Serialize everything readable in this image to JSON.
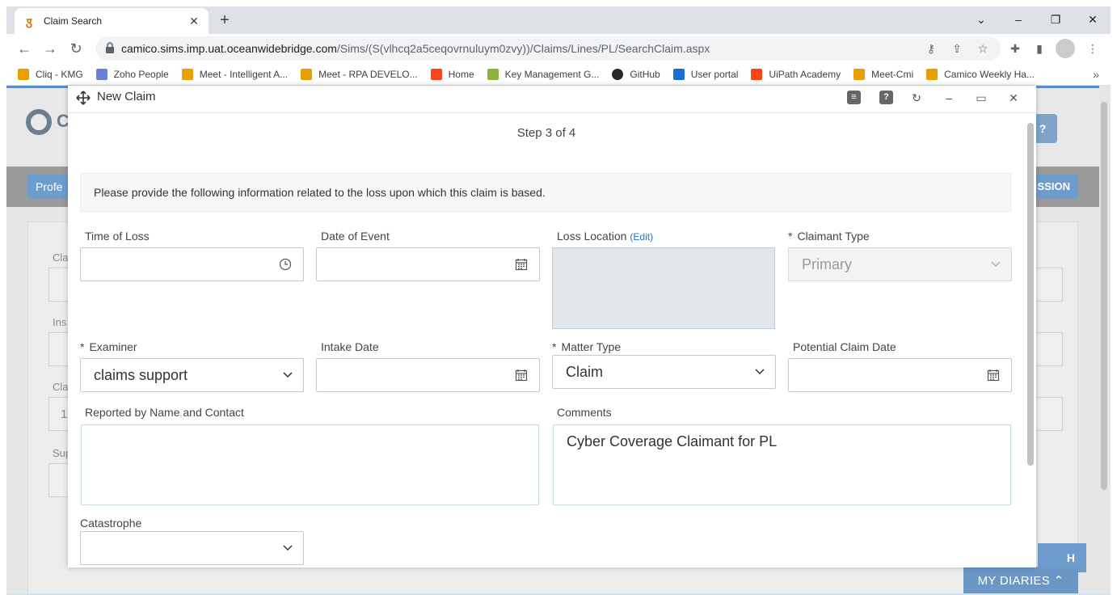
{
  "browser": {
    "tab_title": "Claim Search",
    "tab_favicon": "claim-favicon",
    "new_tab_label": "+",
    "url_host": "camico.sims.imp.uat.oceanwidebridge.com",
    "url_path": "/Sims/(S(vlhcq2a5ceqovrnuluym0zvy))/Claims/Lines/PL/SearchClaim.aspx",
    "bookmarks": [
      {
        "label": "Cliq - KMG",
        "color": "#e8a000",
        "icon": "C"
      },
      {
        "label": "Zoho People",
        "color": "#6a7fd6",
        "icon": "Z"
      },
      {
        "label": "Meet - Intelligent A...",
        "color": "#e8a000",
        "icon": "M"
      },
      {
        "label": "Meet - RPA DEVELO...",
        "color": "#e8a000",
        "icon": "M"
      },
      {
        "label": "Home",
        "color": "#fa4616",
        "icon": "Ui"
      },
      {
        "label": "Key Management G...",
        "color": "#8bb33a",
        "icon": "K"
      },
      {
        "label": "GitHub",
        "color": "#24292e",
        "icon": "G"
      },
      {
        "label": "User portal",
        "color": "#1a6fd6",
        "icon": "S"
      },
      {
        "label": "UiPath Academy",
        "color": "#fa4616",
        "icon": "Ui"
      },
      {
        "label": "Meet-Cmi",
        "color": "#e8a000",
        "icon": "M"
      },
      {
        "label": "Camico Weekly Ha...",
        "color": "#e8a000",
        "icon": "M"
      }
    ],
    "bookmarks_more": "»"
  },
  "background": {
    "logo_letter": "C",
    "help_label": "?",
    "nav_left_label": "Profe",
    "nav_right_label": "SSION",
    "labels": [
      "Cla",
      "Ins",
      "Cla",
      "Sup"
    ],
    "value_fragment": "1",
    "search_fragment": "H",
    "diaries_label": "MY DIARIES",
    "diaries_icon": "^"
  },
  "modal": {
    "title": "New Claim",
    "step": "Step 3 of 4",
    "info": "Please provide the following information related to the loss upon which this claim is based.",
    "fields": {
      "time_of_loss": {
        "label": "Time of Loss",
        "value": ""
      },
      "date_of_event": {
        "label": "Date of Event",
        "value": ""
      },
      "loss_location": {
        "label": "Loss Location",
        "edit": "(Edit)",
        "value": ""
      },
      "claimant_type": {
        "label": "Claimant Type",
        "value": "Primary",
        "required": "*"
      },
      "examiner": {
        "label": "Examiner",
        "value": "claims support",
        "required": "*"
      },
      "intake_date": {
        "label": "Intake Date",
        "value": ""
      },
      "matter_type": {
        "label": "Matter Type",
        "value": "Claim",
        "required": "*"
      },
      "potential_claim_date": {
        "label": "Potential Claim Date",
        "value": ""
      },
      "reported_by": {
        "label": "Reported by Name and Contact",
        "value": ""
      },
      "comments": {
        "label": "Comments",
        "value": "Cyber Coverage Claimant for PL"
      },
      "catastrophe": {
        "label": "Catastrophe",
        "value": ""
      }
    }
  }
}
